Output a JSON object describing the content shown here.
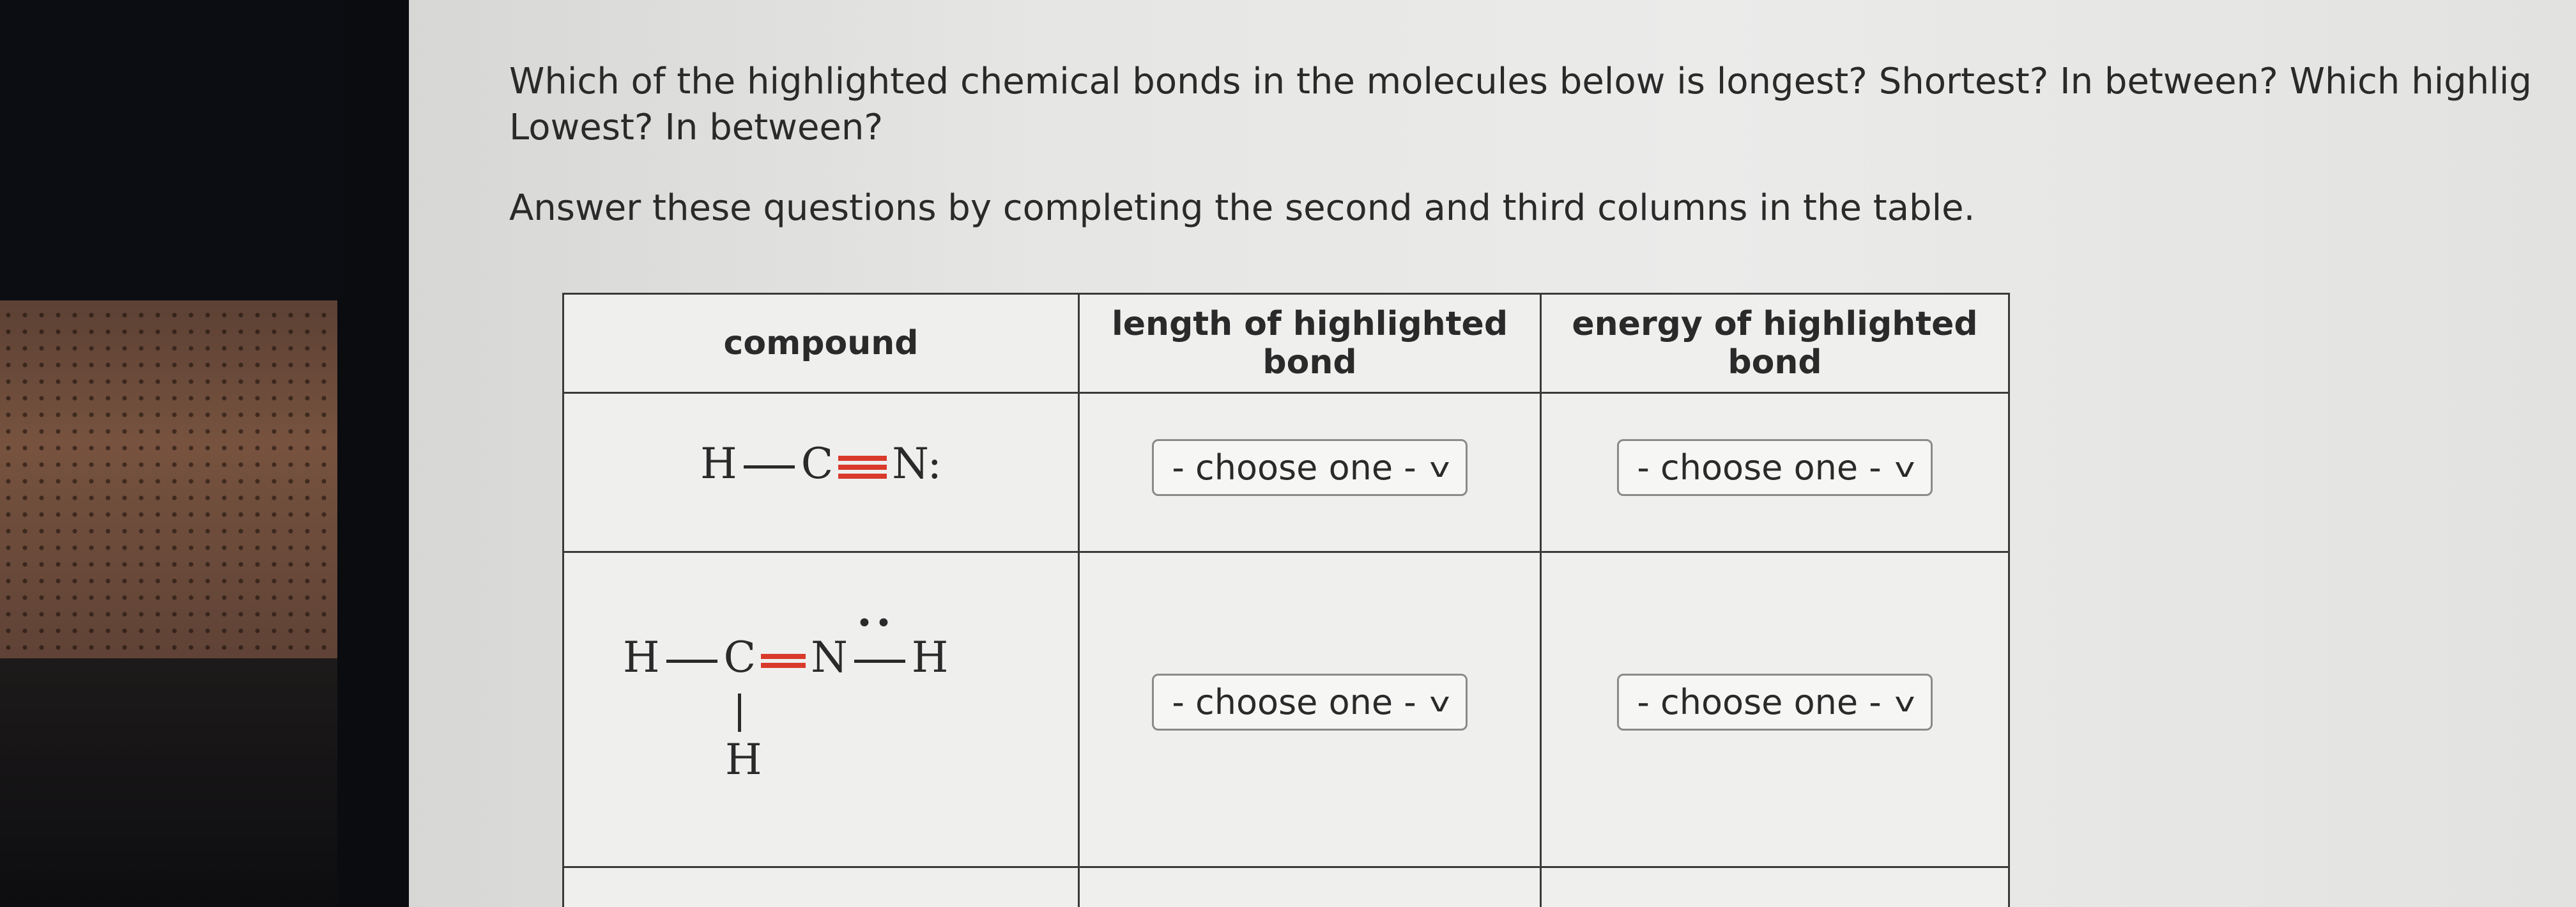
{
  "question": {
    "line1": "Which of the highlighted chemical bonds in the molecules below is longest? Shortest? In between? Which highlig",
    "line2": "Lowest? In between?"
  },
  "instruction": "Answer these questions by completing the second and third columns in the table.",
  "table": {
    "headers": {
      "compound": "compound",
      "length_line1": "length of highlighted",
      "length_line2": "bond",
      "energy_line1": "energy of highlighted",
      "energy_line2": "bond"
    },
    "rows": [
      {
        "molecule": {
          "atom1": "H",
          "atom2": "C",
          "atom3": "N",
          "suffix": ":"
        },
        "length_select": "- choose one -",
        "energy_select": "- choose one -"
      },
      {
        "molecule": {
          "atom1": "H",
          "atom2": "C",
          "atom3": "N",
          "atom4": "H",
          "atom5": "H",
          "lone_pair": "••"
        },
        "length_select": "- choose one -",
        "energy_select": "- choose one -"
      }
    ]
  },
  "colors": {
    "highlight_bond": "#d93a2b"
  },
  "icons": {
    "dropdown": "chevron-down-icon"
  }
}
